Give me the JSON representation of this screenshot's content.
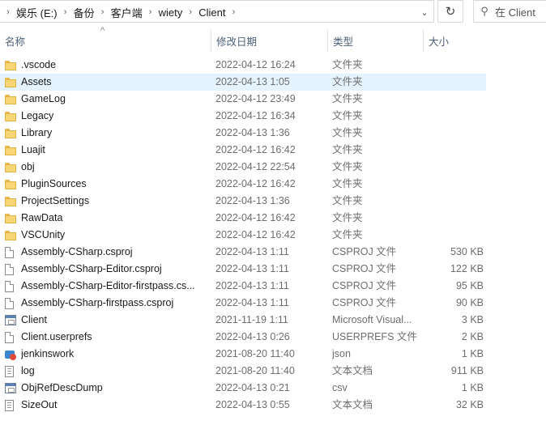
{
  "breadcrumbs": [
    "娱乐 (E:)",
    "备份",
    "客户端",
    "wiety",
    "Client"
  ],
  "search": {
    "placeholder": "在 Client"
  },
  "columns": {
    "name": "名称",
    "date": "修改日期",
    "type": "类型",
    "size": "大小"
  },
  "colors": {
    "selected_row": "#e5f3ff",
    "folder": "#f8d675",
    "header_text": "#4c607a"
  },
  "files": [
    {
      "icon": "folder-icon",
      "name": ".vscode",
      "date": "2022-04-12 16:24",
      "type": "文件夹",
      "size": ""
    },
    {
      "icon": "folder-icon",
      "name": "Assets",
      "date": "2022-04-13 1:05",
      "type": "文件夹",
      "size": "",
      "selected": true
    },
    {
      "icon": "folder-icon",
      "name": "GameLog",
      "date": "2022-04-12 23:49",
      "type": "文件夹",
      "size": ""
    },
    {
      "icon": "folder-icon",
      "name": "Legacy",
      "date": "2022-04-12 16:34",
      "type": "文件夹",
      "size": ""
    },
    {
      "icon": "folder-icon",
      "name": "Library",
      "date": "2022-04-13 1:36",
      "type": "文件夹",
      "size": ""
    },
    {
      "icon": "folder-icon",
      "name": "Luajit",
      "date": "2022-04-12 16:42",
      "type": "文件夹",
      "size": ""
    },
    {
      "icon": "folder-icon",
      "name": "obj",
      "date": "2022-04-12 22:54",
      "type": "文件夹",
      "size": ""
    },
    {
      "icon": "folder-icon",
      "name": "PluginSources",
      "date": "2022-04-12 16:42",
      "type": "文件夹",
      "size": ""
    },
    {
      "icon": "folder-icon",
      "name": "ProjectSettings",
      "date": "2022-04-13 1:36",
      "type": "文件夹",
      "size": ""
    },
    {
      "icon": "folder-icon",
      "name": "RawData",
      "date": "2022-04-12 16:42",
      "type": "文件夹",
      "size": ""
    },
    {
      "icon": "folder-icon",
      "name": "VSCUnity",
      "date": "2022-04-12 16:42",
      "type": "文件夹",
      "size": ""
    },
    {
      "icon": "document-icon",
      "name": "Assembly-CSharp.csproj",
      "date": "2022-04-13 1:11",
      "type": "CSPROJ 文件",
      "size": "530 KB"
    },
    {
      "icon": "document-icon",
      "name": "Assembly-CSharp-Editor.csproj",
      "date": "2022-04-13 1:11",
      "type": "CSPROJ 文件",
      "size": "122 KB"
    },
    {
      "icon": "document-icon",
      "name": "Assembly-CSharp-Editor-firstpass.cs...",
      "date": "2022-04-13 1:11",
      "type": "CSPROJ 文件",
      "size": "95 KB"
    },
    {
      "icon": "document-icon",
      "name": "Assembly-CSharp-firstpass.csproj",
      "date": "2022-04-13 1:11",
      "type": "CSPROJ 文件",
      "size": "90 KB"
    },
    {
      "icon": "solution-icon",
      "name": "Client",
      "date": "2021-11-19 1:11",
      "type": "Microsoft Visual...",
      "size": "3 KB"
    },
    {
      "icon": "document-icon",
      "name": "Client.userprefs",
      "date": "2022-04-13 0:26",
      "type": "USERPREFS 文件",
      "size": "2 KB"
    },
    {
      "icon": "json-icon",
      "name": "jenkinswork",
      "date": "2021-08-20 11:40",
      "type": "json",
      "size": "1 KB"
    },
    {
      "icon": "text-file-icon",
      "name": "log",
      "date": "2021-08-20 11:40",
      "type": "文本文档",
      "size": "911 KB"
    },
    {
      "icon": "csv-icon",
      "name": "ObjRefDescDump",
      "date": "2022-04-13 0:21",
      "type": "csv",
      "size": "1 KB"
    },
    {
      "icon": "text-file-icon",
      "name": "SizeOut",
      "date": "2022-04-13 0:55",
      "type": "文本文档",
      "size": "32 KB"
    }
  ]
}
